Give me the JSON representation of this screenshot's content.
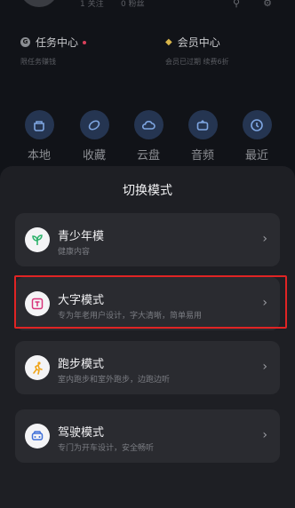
{
  "profile": {
    "follow_text": "1 关注",
    "fans_text": "0 粉丝"
  },
  "cards": {
    "task": {
      "title": "任务中心",
      "subtitle": "限任务赚钱"
    },
    "vip": {
      "title": "会员中心",
      "subtitle": "会员已过期 续费6折"
    }
  },
  "quick_links": [
    {
      "label": "本地",
      "icon": "local-icon"
    },
    {
      "label": "收藏",
      "icon": "heart-icon"
    },
    {
      "label": "云盘",
      "icon": "cloud-icon"
    },
    {
      "label": "音频",
      "icon": "radio-icon"
    },
    {
      "label": "最近",
      "icon": "clock-icon"
    }
  ],
  "sheet": {
    "title": "切换模式",
    "modes": [
      {
        "name": "青少年模",
        "desc": "健康内容",
        "icon": "sprout-icon",
        "color": "#2fb36d"
      },
      {
        "name": "大字模式",
        "desc": "专为年老用户设计，字大清晰，简单易用",
        "icon": "text-t-icon",
        "color": "#d8337a"
      },
      {
        "name": "跑步模式",
        "desc": "室内跑步和室外跑步，边跑边听",
        "icon": "runner-icon",
        "color": "#f0a418"
      },
      {
        "name": "驾驶模式",
        "desc": "专门为开车设计，安全畅听",
        "icon": "car-icon",
        "color": "#3f6fd8"
      }
    ]
  }
}
